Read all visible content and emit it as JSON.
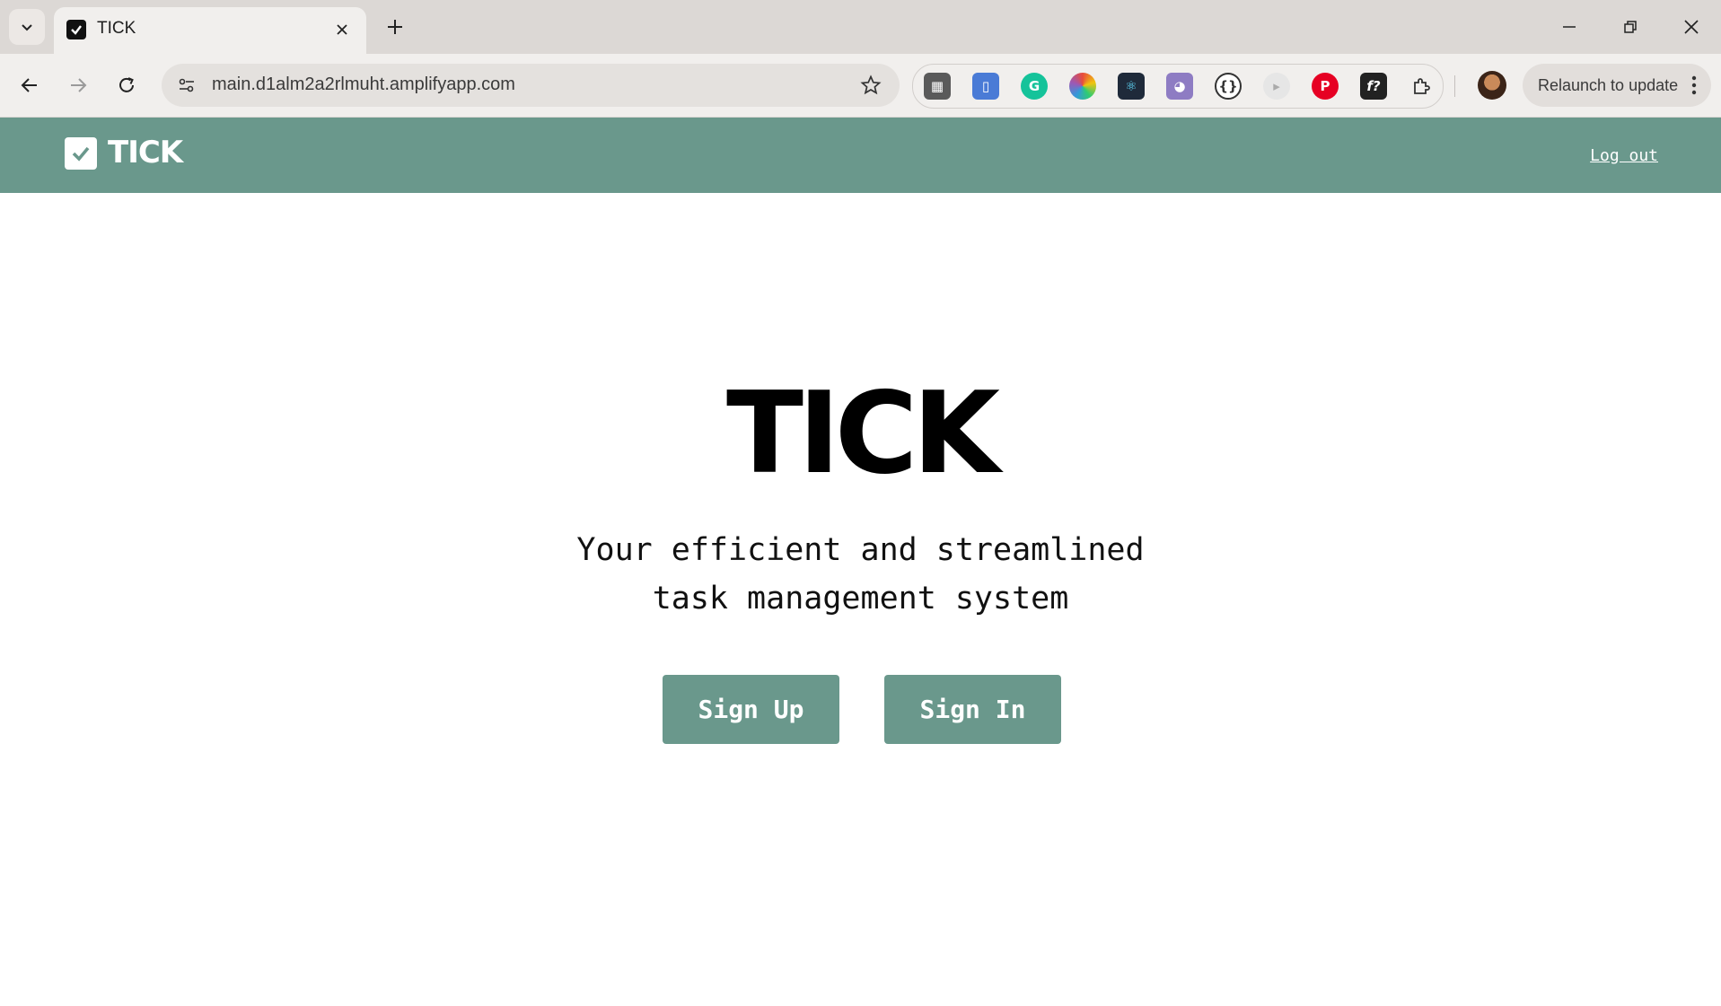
{
  "browser": {
    "tab_title": "TICK",
    "url": "main.d1alm2a2rlmuht.amplifyapp.com",
    "relaunch_label": "Relaunch to update",
    "extensions": [
      {
        "icon": "qr-code-icon",
        "color": "#5a5a5a"
      },
      {
        "icon": "clipboard-icon",
        "color": "#4a7bd6"
      },
      {
        "icon": "grammarly-icon",
        "color": "#15c39a"
      },
      {
        "icon": "color-picker-icon",
        "color": "#e84c3d"
      },
      {
        "icon": "react-devtools-icon",
        "color": "#1f2a3a"
      },
      {
        "icon": "octocat-icon",
        "color": "#8e7cc3"
      },
      {
        "icon": "json-viewer-icon",
        "color": "#3a3a3a"
      },
      {
        "icon": "media-icon",
        "color": "#b0b0b0"
      },
      {
        "icon": "pinterest-icon",
        "color": "#e60023"
      },
      {
        "icon": "font-icon",
        "color": "#222222"
      },
      {
        "icon": "extensions-puzzle-icon",
        "color": "#3a3a3a"
      }
    ]
  },
  "header": {
    "logo_text": "TICK",
    "logout_label": "Log out",
    "color": "#6a988c"
  },
  "hero": {
    "title": "TICK",
    "tagline_line1": "Your efficient and streamlined",
    "tagline_line2": "task management system",
    "signup_label": "Sign Up",
    "signin_label": "Sign In"
  }
}
